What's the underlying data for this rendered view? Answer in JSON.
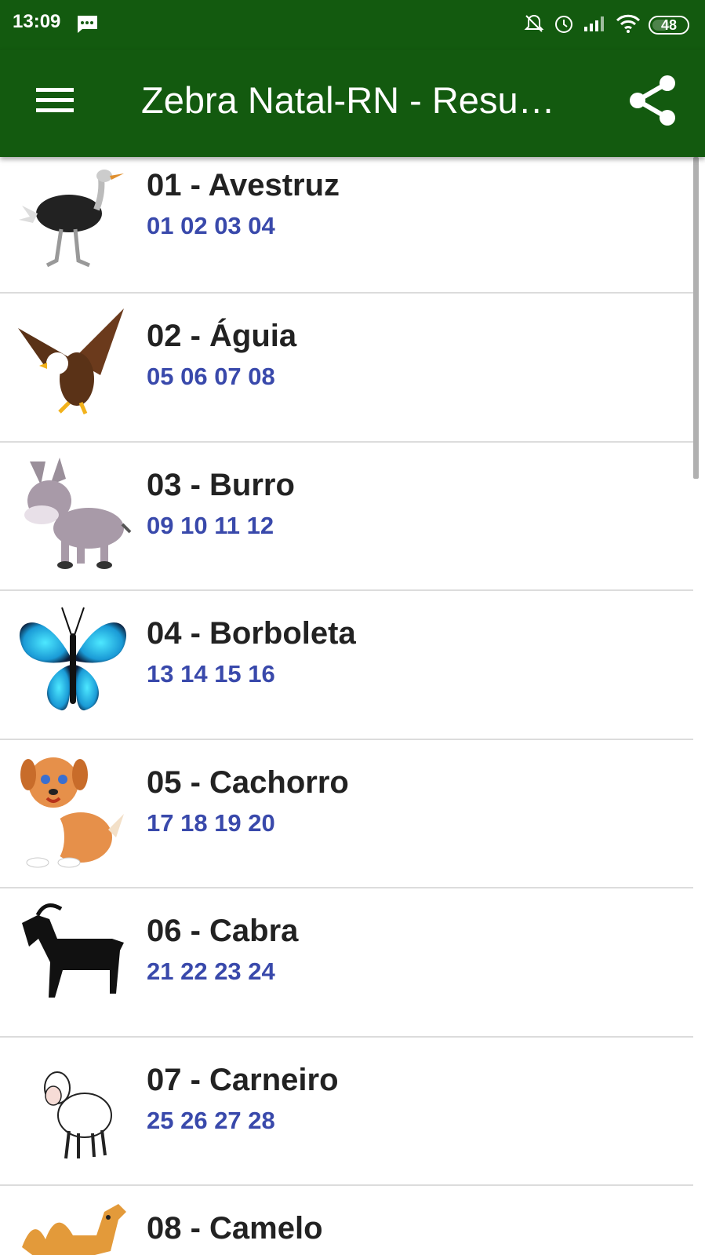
{
  "status_bar": {
    "time": "13:09",
    "battery": "48",
    "icons": [
      "message-icon",
      "notifications-off-icon",
      "alarm-icon",
      "signal-icon",
      "wifi-icon",
      "battery-icon"
    ]
  },
  "app_bar": {
    "title": "Zebra Natal-RN - Resu…",
    "menu_icon": "hamburger-menu-icon",
    "share_icon": "share-icon",
    "color": "#135a0f"
  },
  "colors": {
    "numbers": "#3949ab",
    "title": "#222222"
  },
  "animals": [
    {
      "title": "01 - Avestruz",
      "numbers": "01 02 03 04",
      "icon": "ostrich-icon"
    },
    {
      "title": "02 - Águia",
      "numbers": "05 06 07 08",
      "icon": "eagle-icon"
    },
    {
      "title": "03 - Burro",
      "numbers": "09 10 11 12",
      "icon": "donkey-icon"
    },
    {
      "title": "04 - Borboleta",
      "numbers": "13 14 15 16",
      "icon": "butterfly-icon"
    },
    {
      "title": "05 - Cachorro",
      "numbers": "17 18 19 20",
      "icon": "dog-icon"
    },
    {
      "title": "06 - Cabra",
      "numbers": "21 22 23 24",
      "icon": "goat-icon"
    },
    {
      "title": "07 - Carneiro",
      "numbers": "25 26 27 28",
      "icon": "sheep-icon"
    },
    {
      "title": "08 - Camelo",
      "numbers": "",
      "icon": "camel-icon"
    }
  ]
}
